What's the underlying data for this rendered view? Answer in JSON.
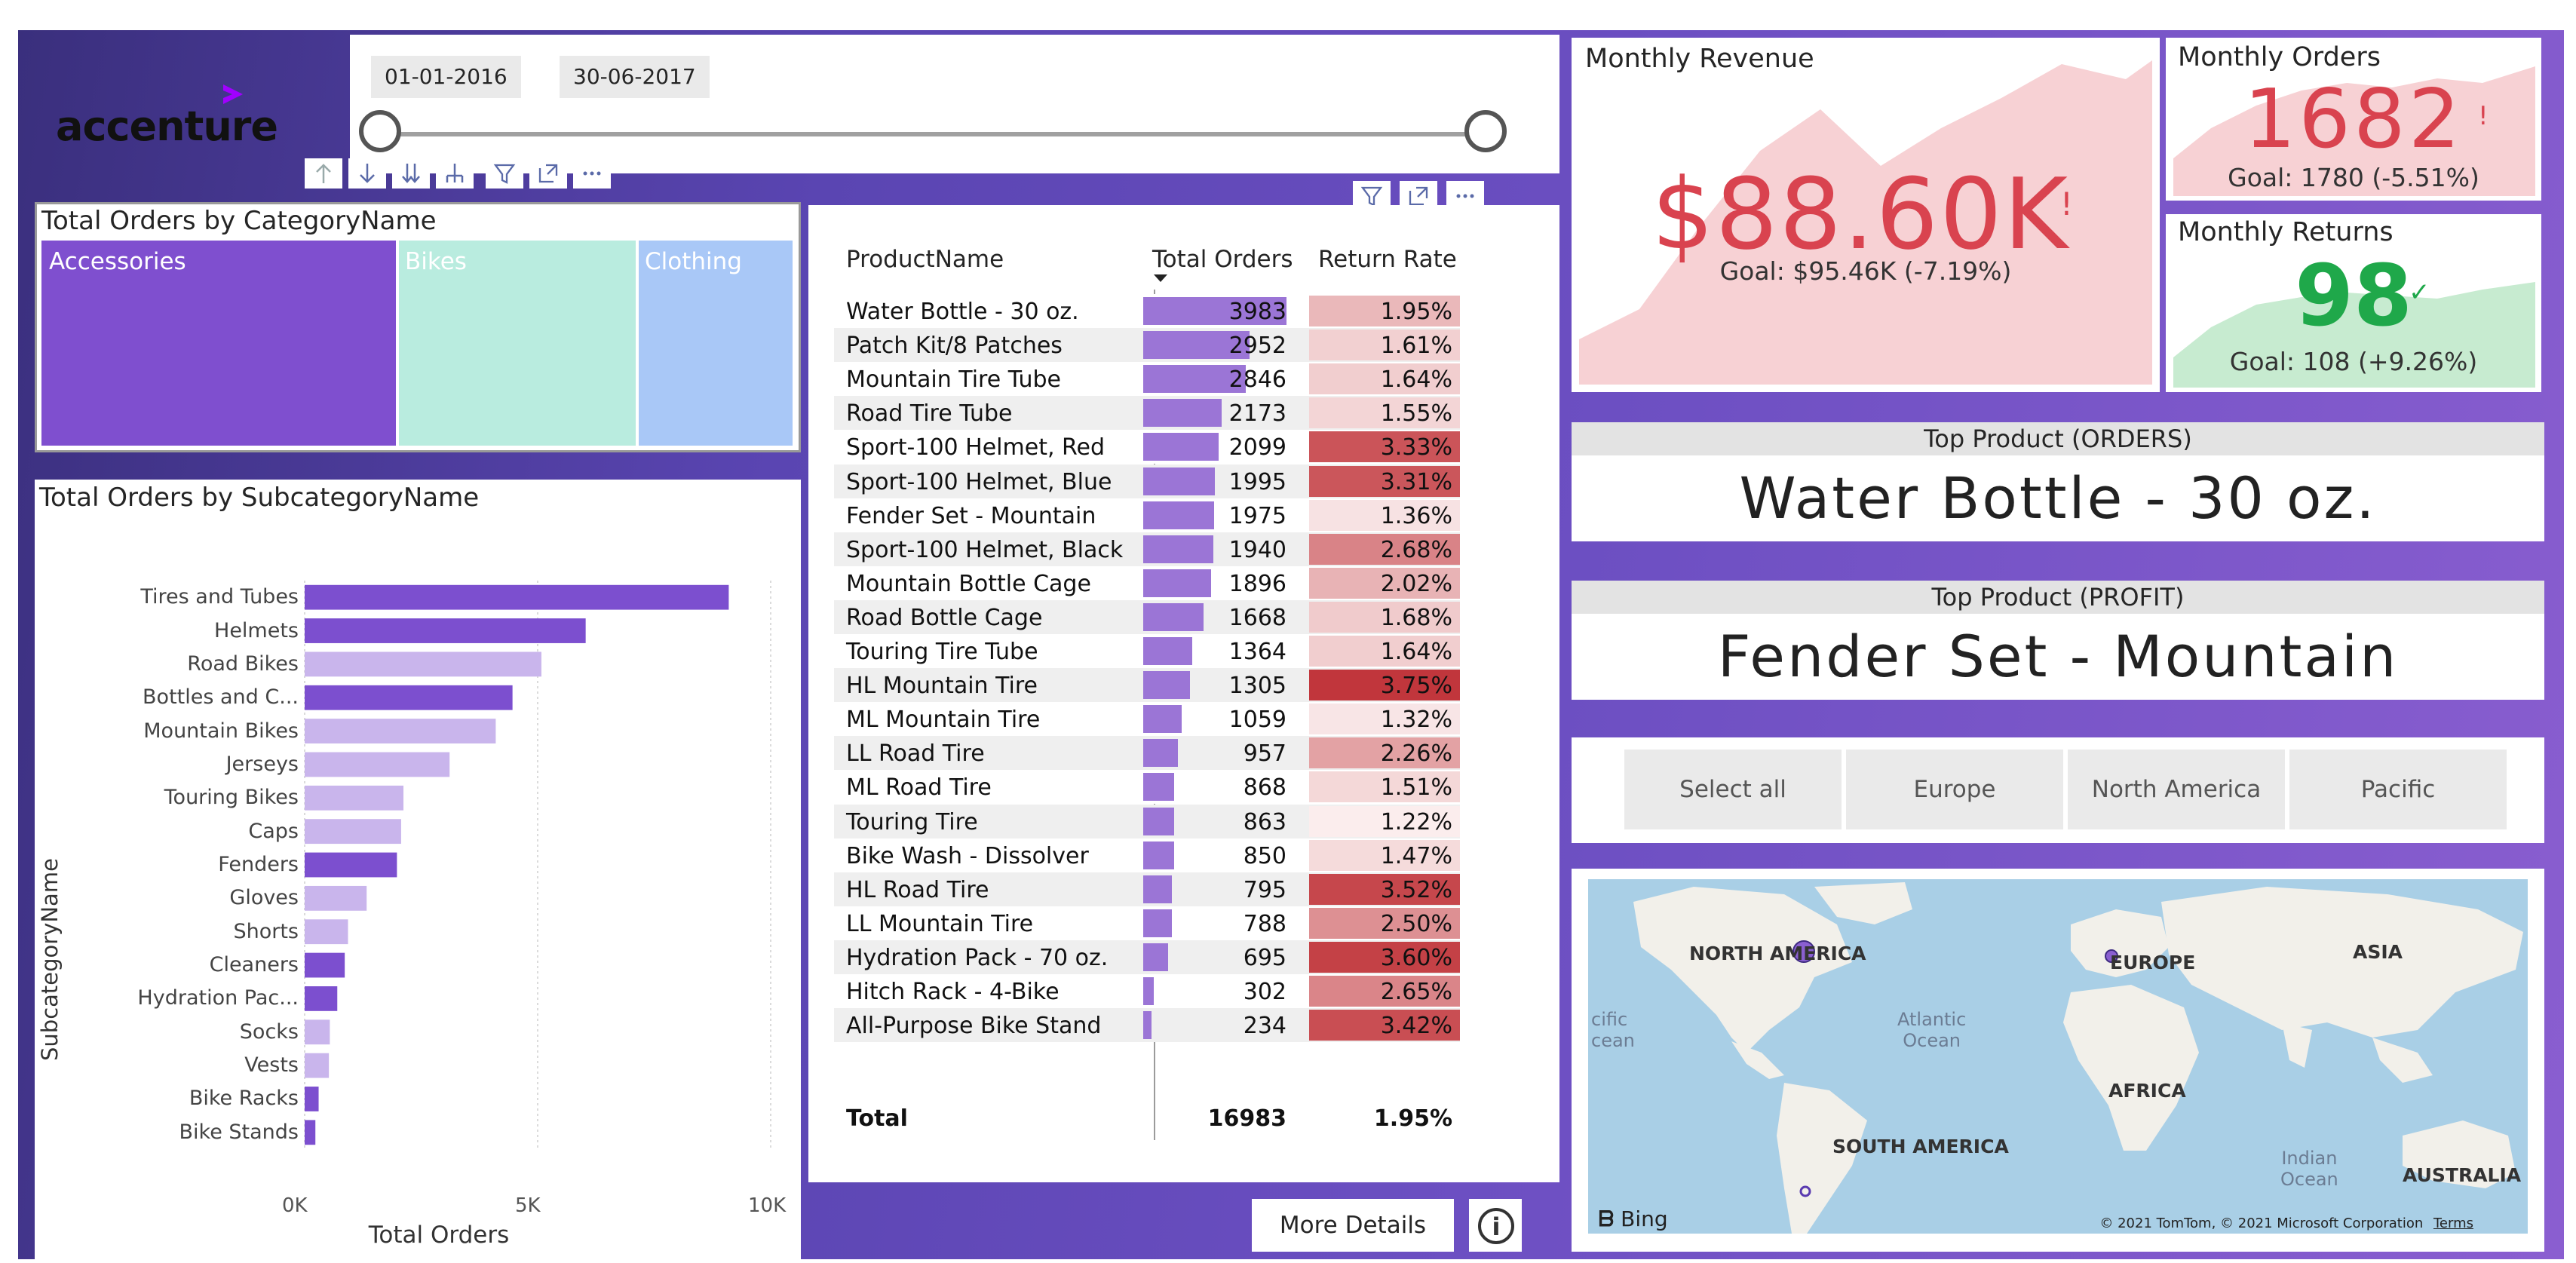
{
  "brand": {
    "logo_text": "accenture",
    "accent": "#a100ff"
  },
  "date_slicer": {
    "start": "01-01-2016",
    "end": "30-06-2017",
    "range": [
      0,
      1
    ]
  },
  "category_treemap": {
    "title": "Total Orders by CategoryName",
    "tiles": [
      {
        "label": "Accessories",
        "color": "#7f4fcf"
      },
      {
        "label": "Bikes",
        "color": "#b9ecdf"
      },
      {
        "label": "Clothing",
        "color": "#a9c8f7"
      }
    ]
  },
  "subcategory_chart": {
    "title": "Total Orders by SubcategoryName",
    "chart_data": {
      "type": "bar",
      "orientation": "horizontal",
      "title": "Total Orders by SubcategoryName",
      "xlabel": "Total Orders",
      "ylabel": "SubcategoryName",
      "xlim": [
        0,
        10000
      ],
      "x_ticks": [
        "0K",
        "5K",
        "10K"
      ],
      "categories": [
        "Tires and Tubes",
        "Helmets",
        "Road Bikes",
        "Bottles and C...",
        "Mountain Bikes",
        "Jerseys",
        "Touring Bikes",
        "Caps",
        "Fenders",
        "Gloves",
        "Shorts",
        "Cleaners",
        "Hydration Pac...",
        "Socks",
        "Vests",
        "Bike Racks",
        "Bike Stands"
      ],
      "values": [
        9100,
        6030,
        5080,
        4460,
        4100,
        3110,
        2120,
        2070,
        1980,
        1330,
        930,
        860,
        700,
        540,
        520,
        300,
        230
      ],
      "bar_colors": [
        "#7c4fcf",
        "#7c4fcf",
        "#c9b5ec",
        "#7c4fcf",
        "#c9b5ec",
        "#c9b5ec",
        "#c9b5ec",
        "#c9b5ec",
        "#7c4fcf",
        "#c9b5ec",
        "#c9b5ec",
        "#7c4fcf",
        "#7c4fcf",
        "#c9b5ec",
        "#c9b5ec",
        "#7c4fcf",
        "#7c4fcf"
      ],
      "grid": true
    }
  },
  "product_table": {
    "columns": [
      "ProductName",
      "Total Orders",
      "Return Rate"
    ],
    "rows": [
      {
        "name": "Water Bottle - 30 oz.",
        "orders": 3983,
        "return_rate": "1.95%"
      },
      {
        "name": "Patch Kit/8 Patches",
        "orders": 2952,
        "return_rate": "1.61%"
      },
      {
        "name": "Mountain Tire Tube",
        "orders": 2846,
        "return_rate": "1.64%"
      },
      {
        "name": "Road Tire Tube",
        "orders": 2173,
        "return_rate": "1.55%"
      },
      {
        "name": "Sport-100 Helmet, Red",
        "orders": 2099,
        "return_rate": "3.33%"
      },
      {
        "name": "Sport-100 Helmet, Blue",
        "orders": 1995,
        "return_rate": "3.31%"
      },
      {
        "name": "Fender Set - Mountain",
        "orders": 1975,
        "return_rate": "1.36%"
      },
      {
        "name": "Sport-100 Helmet, Black",
        "orders": 1940,
        "return_rate": "2.68%"
      },
      {
        "name": "Mountain Bottle Cage",
        "orders": 1896,
        "return_rate": "2.02%"
      },
      {
        "name": "Road Bottle Cage",
        "orders": 1668,
        "return_rate": "1.68%"
      },
      {
        "name": "Touring Tire Tube",
        "orders": 1364,
        "return_rate": "1.64%"
      },
      {
        "name": "HL Mountain Tire",
        "orders": 1305,
        "return_rate": "3.75%"
      },
      {
        "name": "ML Mountain Tire",
        "orders": 1059,
        "return_rate": "1.32%"
      },
      {
        "name": "LL Road Tire",
        "orders": 957,
        "return_rate": "2.26%"
      },
      {
        "name": "ML Road Tire",
        "orders": 868,
        "return_rate": "1.51%"
      },
      {
        "name": "Touring Tire",
        "orders": 863,
        "return_rate": "1.22%"
      },
      {
        "name": "Bike Wash - Dissolver",
        "orders": 850,
        "return_rate": "1.47%"
      },
      {
        "name": "HL Road Tire",
        "orders": 795,
        "return_rate": "3.52%"
      },
      {
        "name": "LL Mountain Tire",
        "orders": 788,
        "return_rate": "2.50%"
      },
      {
        "name": "Hydration Pack - 70 oz.",
        "orders": 695,
        "return_rate": "3.60%"
      },
      {
        "name": "Hitch Rack - 4-Bike",
        "orders": 302,
        "return_rate": "2.65%"
      },
      {
        "name": "All-Purpose Bike Stand",
        "orders": 234,
        "return_rate": "3.42%"
      }
    ],
    "total": {
      "label": "Total",
      "orders": "16983",
      "return_rate": "1.95%"
    }
  },
  "monthly_revenue": {
    "title": "Monthly Revenue",
    "value": "$88.60K",
    "flag": "!",
    "goal": "Goal: $95.46K (-7.19%)",
    "color": "#d9434f"
  },
  "monthly_orders": {
    "title": "Monthly Orders",
    "value": "1682",
    "flag": "!",
    "goal": "Goal: 1780 (-5.51%)",
    "color": "#d9434f"
  },
  "monthly_returns": {
    "title": "Monthly Returns",
    "value": "98",
    "flag": "✓",
    "goal": "Goal: 108 (+9.26%)",
    "color": "#1fa84a"
  },
  "top_product_orders": {
    "header": "Top Product (ORDERS)",
    "value": "Water Bottle - 30 oz."
  },
  "top_product_profit": {
    "header": "Top Product (PROFIT)",
    "value": "Fender Set - Mountain"
  },
  "region_slicer": {
    "options": [
      "Select all",
      "Europe",
      "North America",
      "Pacific"
    ]
  },
  "map": {
    "labels": {
      "north_america": "NORTH AMERICA",
      "europe": "EUROPE",
      "asia": "ASIA",
      "africa": "AFRICA",
      "south_america": "SOUTH AMERICA",
      "australia": "AUSTRALIA",
      "atlantic": "Atlantic\nOcean",
      "pacific": "cific\ncean",
      "indian": "Indian\nOcean"
    },
    "provider": "Bing",
    "copyright": "© 2021 TomTom, © 2021 Microsoft Corporation",
    "terms": "Terms"
  },
  "buttons": {
    "more_details": "More Details",
    "info": "i"
  }
}
